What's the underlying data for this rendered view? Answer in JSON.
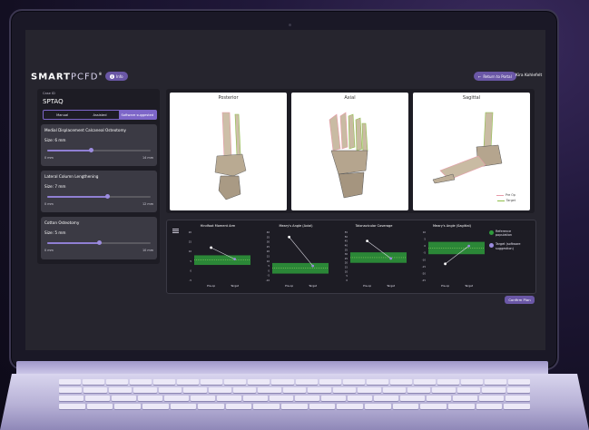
{
  "header": {
    "logo_bold": "SMART",
    "logo_thin": "PCFD",
    "logo_mark": "®",
    "info_label": "Info",
    "return_label": "Return to Portal",
    "user_name": "Kira Kohlefelt"
  },
  "case": {
    "label": "Case ID",
    "id": "SPTAQ"
  },
  "mode_tabs": [
    {
      "label": "Manual",
      "active": false
    },
    {
      "label": "Assisted",
      "active": false
    },
    {
      "label": "Software suggested",
      "active": true
    }
  ],
  "procedures": [
    {
      "title": "Medial Displacement Calcaneal Osteotomy",
      "size": "Size: 6 mm",
      "min": "0 mm",
      "max": "14 mm",
      "value": 6,
      "range": [
        0,
        14
      ]
    },
    {
      "title": "Lateral Column Lengthening",
      "size": "Size: 7 mm",
      "min": "0 mm",
      "max": "12 mm",
      "value": 7,
      "range": [
        0,
        12
      ]
    },
    {
      "title": "Cotton Osteotomy",
      "size": "Size: 5 mm",
      "min": "0 mm",
      "max": "10 mm",
      "value": 5,
      "range": [
        0,
        10
      ]
    }
  ],
  "views": [
    {
      "title": "Posterior"
    },
    {
      "title": "Axial"
    },
    {
      "title": "Sagittal"
    }
  ],
  "view_legend": [
    {
      "label": "Pre Op",
      "color": "#e89aa8"
    },
    {
      "label": "Target",
      "color": "#8fbf4a"
    }
  ],
  "chart_data": [
    {
      "type": "line",
      "title": "Hindfoot Moment Arm",
      "categories": [
        "Pre-op",
        "Target"
      ],
      "values": [
        12,
        6
      ],
      "ylim": [
        -5,
        20
      ],
      "ticks": [
        "20",
        "15",
        "10",
        "5",
        "0",
        "-5"
      ],
      "band": [
        3,
        8
      ]
    },
    {
      "type": "line",
      "title": "Meary's Angle (Axial)",
      "categories": [
        "Pre-op",
        "Target"
      ],
      "values": [
        35,
        5
      ],
      "ylim": [
        -10,
        40
      ],
      "ticks": [
        "40",
        "35",
        "30",
        "25",
        "20",
        "15",
        "10",
        "5",
        "0",
        "-5",
        "-10"
      ],
      "band": [
        -3,
        8
      ]
    },
    {
      "type": "line",
      "title": "Talonavicular Coverage",
      "categories": [
        "Pre-op",
        "Target"
      ],
      "values": [
        45,
        25
      ],
      "ylim": [
        0,
        55
      ],
      "ticks": [
        "55",
        "50",
        "45",
        "40",
        "35",
        "30",
        "25",
        "20",
        "15",
        "10",
        "5",
        "0"
      ],
      "band": [
        20,
        32
      ]
    },
    {
      "type": "line",
      "title": "Meary's Angle (Sagittal)",
      "categories": [
        "Pre-op",
        "Target"
      ],
      "values": [
        -13,
        0
      ],
      "ylim": [
        -25,
        10
      ],
      "ticks": [
        "10",
        "5",
        "0",
        "-5",
        "-10",
        "-15",
        "-20",
        "-25"
      ],
      "band": [
        -6,
        3
      ]
    }
  ],
  "metrics_legend": [
    {
      "label": "Reference population",
      "color": "#2e9a3b"
    },
    {
      "label": "Target (software suggestion)",
      "color": "#9c8cdf"
    }
  ],
  "confirm_label": "Confirm Plan"
}
